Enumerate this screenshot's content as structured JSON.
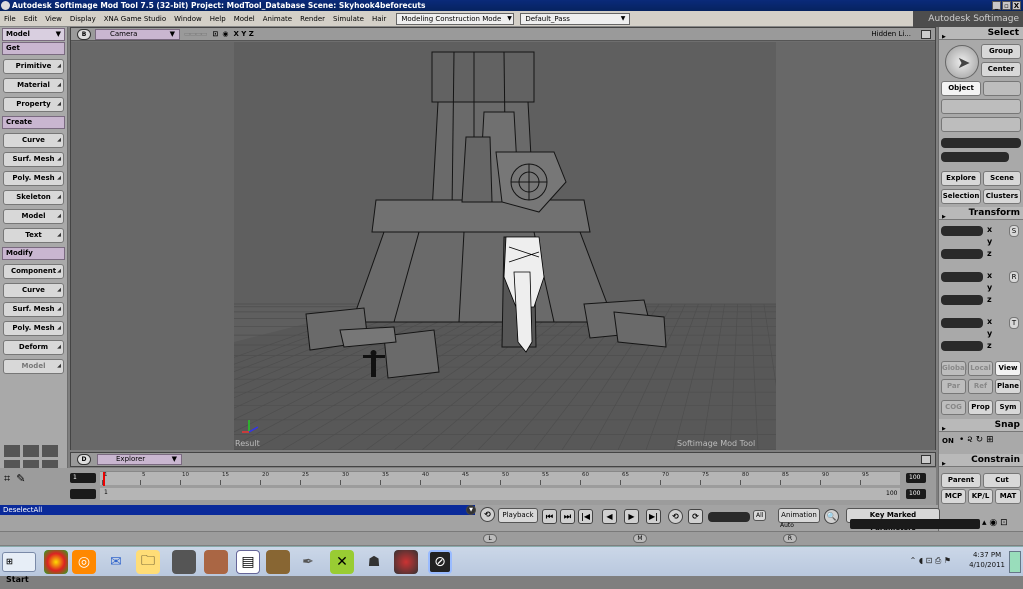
{
  "titlebar": {
    "title": "Autodesk Softimage Mod Tool 7.5 (32-bit)    Project: ModTool_Database    Scene: Skyhook4beforecuts",
    "buttons": [
      "_",
      "▫",
      "X"
    ]
  },
  "menubar": {
    "items": [
      "File",
      "Edit",
      "View",
      "Display",
      "XNA Game Studio",
      "Window",
      "Help",
      "Model",
      "Animate",
      "Render",
      "Simulate",
      "Hair"
    ],
    "construction_mode": "Modeling Construction Mode",
    "pass": "Default_Pass",
    "brand": "Autodesk Softimage"
  },
  "left_panel": {
    "mode": "Model",
    "sections": [
      {
        "title": "Get",
        "buttons": [
          "Primitive",
          "Material",
          "Property"
        ]
      },
      {
        "title": "Create",
        "buttons": [
          "Curve",
          "Surf. Mesh",
          "Poly. Mesh",
          "Skeleton",
          "Model",
          "Text"
        ]
      },
      {
        "title": "Modify",
        "buttons": [
          "Component",
          "Curve",
          "Surf. Mesh",
          "Poly. Mesh",
          "Deform",
          "Model"
        ]
      }
    ]
  },
  "viewport": {
    "letter": "B",
    "camera": "Camera",
    "axes_label": "X Y Z",
    "hidden_label": "Hidden Li...",
    "result_label": "Result",
    "brand_label": "Softimage Mod Tool"
  },
  "explorer": {
    "letter": "D",
    "label": "Explorer"
  },
  "timeline": {
    "start": "1",
    "end": "100",
    "end2": "100",
    "current": "1",
    "ticks": [
      "1",
      "5",
      "10",
      "15",
      "20",
      "25",
      "30",
      "35",
      "40",
      "45",
      "50",
      "55",
      "60",
      "65",
      "70",
      "75",
      "80",
      "85",
      "90",
      "95"
    ]
  },
  "right_panel": {
    "select_title": "Select",
    "group_label": "Group",
    "center_label": "Center",
    "object_label": "Object",
    "explore_label": "Explore",
    "scene_label": "Scene",
    "selection_label": "Selection",
    "clusters_label": "Clusters",
    "transform_title": "Transform",
    "axes": [
      "x",
      "y",
      "z"
    ],
    "side_labels": [
      "S",
      "R",
      "T"
    ],
    "global_label": "Global",
    "local_label": "Local",
    "view_label": "View",
    "par_label": "Par",
    "ref_label": "Ref",
    "plane_label": "Plane",
    "cog_label": "COG",
    "prop_label": "Prop",
    "sym_label": "Sym",
    "snap_title": "Snap",
    "on_label": "ON",
    "constrain_title": "Constrain",
    "parent_label": "Parent",
    "cut_label": "Cut",
    "mcp_label": "MCP",
    "kpl_label": "KP/L",
    "mat_label": "MAT"
  },
  "playbar": {
    "command": "DeselectAll",
    "playback_label": "Playback",
    "all_label": "All",
    "animation_label": "Animation",
    "auto_label": "Auto",
    "key_marked": "Key Marked Parameters",
    "transport": [
      "⏮",
      "⏭",
      "|◀",
      "◀",
      "▶",
      "▶|",
      "⟲",
      "⟳"
    ]
  },
  "keybar": {
    "labels": [
      "L",
      "M",
      "R"
    ]
  },
  "taskbar": {
    "start_label": "Start",
    "apps": [
      "chrome-icon",
      "outlook-icon",
      "messenger-icon",
      "folder-icon",
      "game-icon",
      "winrar-icon",
      "app1-icon",
      "app2-icon",
      "paint-icon",
      "xbox-icon",
      "char-icon",
      "app3-icon",
      "softimage-icon"
    ],
    "time": "4:37 PM",
    "date": "4/10/2011"
  }
}
